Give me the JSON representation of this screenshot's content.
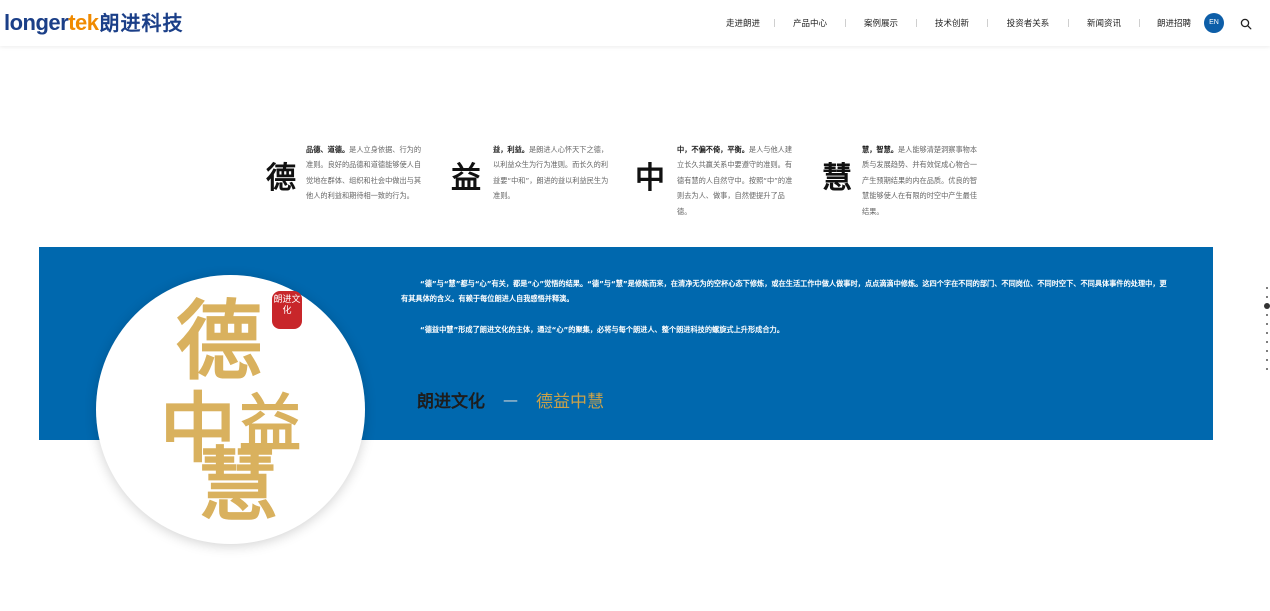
{
  "header": {
    "logo": {
      "part1": "longer",
      "part2": "tek",
      "part3": "朗进科技"
    },
    "nav": [
      {
        "label": "走进朗进",
        "w": 62
      },
      {
        "label": "产品中心",
        "w": 70
      },
      {
        "label": "案例展示",
        "w": 70
      },
      {
        "label": "技术创新",
        "w": 70
      },
      {
        "label": "投资者关系",
        "w": 80
      },
      {
        "label": "新闻资讯",
        "w": 70
      },
      {
        "label": "朗进招聘",
        "w": 68
      }
    ],
    "lang_label": "EN",
    "search_icon": "search-icon"
  },
  "values": [
    {
      "char": "德",
      "lead": "品德、道德。",
      "text": "是人立身依据、行为的准则。良好的品德和道德能够使人自觉地在群体、组织和社会中做出与其他人的利益和期待相一致的行为。"
    },
    {
      "char": "益",
      "lead": "益，利益。",
      "text": "是朗进人心怀天下之德，以利益众生为行为准则。而长久的利益要“中和”，朗进的益以利益民生为准则。"
    },
    {
      "char": "中",
      "lead": "中，不偏不倚，平衡。",
      "text": "是人与他人建立长久共赢关系中要遵守的准则。有德有慧的人自然守中。按照“中”的准则去为人、做事，自然便提升了品德。"
    },
    {
      "char": "慧",
      "lead": "慧，智慧。",
      "text": "是人能够清楚洞察事物本质与发展趋势、并有效促成心物合一产生预期结果的内在品质。优良的智慧能够使人在有限的时空中产生最佳结果。"
    }
  ],
  "band": {
    "paragraph1": "“德”与“慧”都与“心”有关，都是“心”觉悟的结果。“德”与“慧”是修炼而来，在清净无为的空杯心态下修炼，或在生活工作中做人做事时，点点滴滴中修炼。这四个字在不同的部门、不同岗位、不同时空下、不同具体事件的处理中，更有其具体的含义。有赖于每位朗进人自我感悟并释演。",
    "paragraph2": "“德益中慧”形成了朗进文化的主体，通过“心”的聚集，必将与每个朗进人、整个朗进科技的螺旋式上升形成合力。",
    "title": "朗进文化",
    "dash": "—",
    "subtitle": "德益中慧"
  },
  "emblem": {
    "seal_text": "朗进文化",
    "chars": [
      "德",
      "益",
      "中",
      "慧"
    ]
  },
  "side_dots": {
    "count": 10,
    "active_index": 2
  }
}
